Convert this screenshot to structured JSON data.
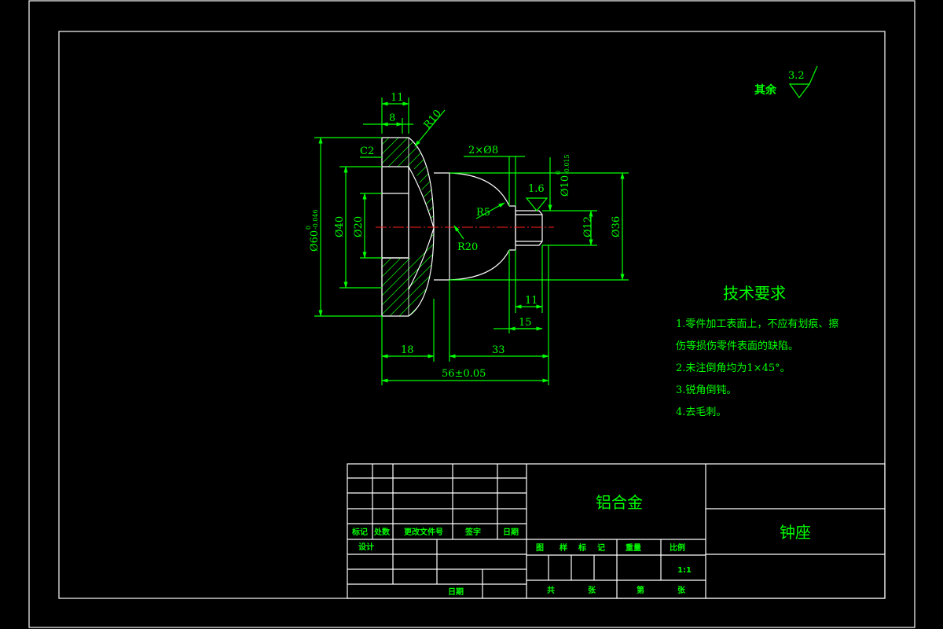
{
  "drawing": {
    "surface_roughness": {
      "prefix": "其余",
      "value": "3.2"
    },
    "dimensions": {
      "d11_top": "11",
      "d8_top": "8",
      "r10": "R10",
      "c2": "C2",
      "holes": "2×Ø8",
      "tol_top": "0",
      "tol_bottom": "-0.015",
      "d10_base": "Ø10",
      "roughness_16": "1.6",
      "r5": "R5",
      "r20": "R20",
      "d60_base": "Ø60",
      "d60_tol_top": "0",
      "d60_tol_bottom": "-0.046",
      "d40": "Ø40",
      "d20": "Ø20",
      "d12": "Ø12",
      "d36": "Ø36",
      "d11_bottom": "11",
      "d15": "15",
      "d18": "18",
      "d33": "33",
      "d56": "56±0.05"
    }
  },
  "tech_requirements": {
    "heading": "技术要求",
    "items": [
      "1.零件加工表面上，不应有划痕、擦",
      "伤等损伤零件表面的缺陷。",
      "2.未注倒角均为1×45°。",
      "3.锐角倒钝。",
      "4.去毛刺。"
    ]
  },
  "title_block": {
    "material": "铝合金",
    "part_name": "钟座",
    "rev_headers": [
      "标记",
      "处数",
      "更改文件号",
      "签字",
      "日期"
    ],
    "design_label": "设计",
    "date_label": "日期",
    "stage_headers": [
      "图",
      "样",
      "标",
      "记"
    ],
    "weight_label": "重量",
    "scale_label": "比例",
    "scale_value": "1:1",
    "sheet_total_label": "共",
    "sheet_total_unit": "张",
    "sheet_label": "第",
    "sheet_unit": "张"
  }
}
